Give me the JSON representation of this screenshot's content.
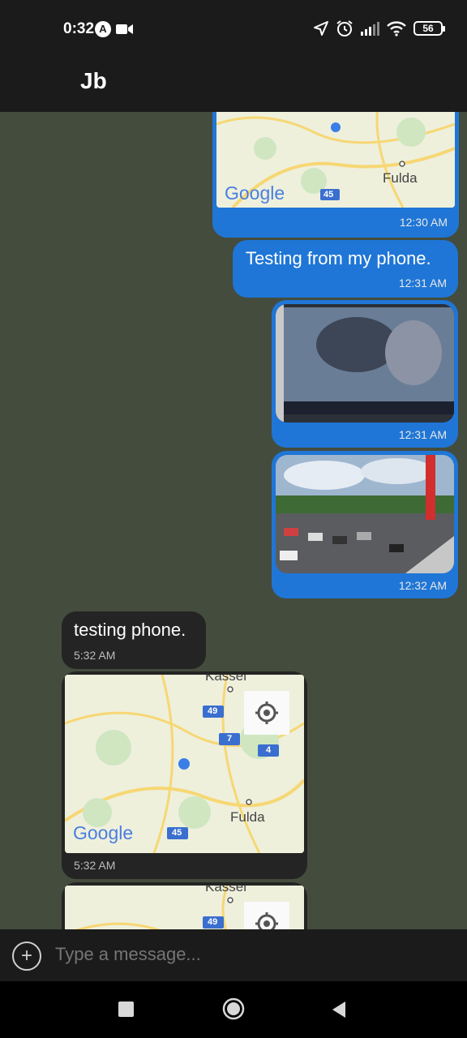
{
  "status_bar": {
    "time": "0:32",
    "auto_badge": "A",
    "battery": "56"
  },
  "header": {
    "title": "Jb"
  },
  "messages": {
    "m1": {
      "time": "12:30 AM",
      "map_city": "Fulda",
      "map_logo": "Google",
      "map_road": "45"
    },
    "m2": {
      "text": "Testing from my phone.",
      "time": "12:31 AM"
    },
    "m3": {
      "time": "12:31 AM"
    },
    "m4": {
      "time": "12:32 AM"
    },
    "m5": {
      "text": "testing phone.",
      "time": "5:32 AM"
    },
    "m6": {
      "time": "5:32 AM",
      "map_top": "Kassel",
      "map_city": "Fulda",
      "map_logo": "Google",
      "road_a": "49",
      "road_b": "7",
      "road_c": "4",
      "road_d": "45"
    },
    "m7": {
      "map_top": "Kassel",
      "road_a": "49"
    }
  },
  "composer": {
    "placeholder": "Type a message...",
    "add_label": "+"
  }
}
